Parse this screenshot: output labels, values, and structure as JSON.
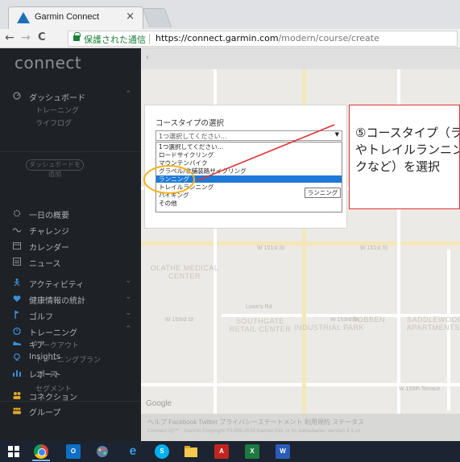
{
  "browser": {
    "tab_title": "Garmin Connect",
    "tab_close": "×",
    "nav_back": "←",
    "nav_forward": "→",
    "nav_reload": "C",
    "secure_label": "保護された通信",
    "url_host": "https://connect.garmin.com",
    "url_path": "/modern/course/create"
  },
  "sidebar": {
    "logo": "connect",
    "dashboard": "ダッシュボード",
    "dashboard_sub": [
      "トレーニング",
      "ライフログ"
    ],
    "dashboard_edit": "ダッシュボードを追加",
    "items": [
      "一日の概要",
      "チャレンジ",
      "カレンダー",
      "ニュース",
      "アクティビティ",
      "健康情報の統計",
      "ゴルフ",
      "トレーニング"
    ],
    "training_sub": [
      "ワークアウト",
      "トレーニングプラン",
      "コース",
      "セグメント"
    ],
    "bottom_items": [
      "ギア",
      "Insights",
      "レポート",
      "コネクション",
      "グループ"
    ],
    "chevron": "⌃"
  },
  "map": {
    "back_arrow": "‹",
    "labels": {
      "olathe": "OLATHE MEDICAL CENTER",
      "southgate": "SOUTHGATE RETAIL CENTER",
      "industrial": "INDUSTRIAL PARK",
      "robben": "ROBBEN",
      "saddlewood": "SADDLEWOOD APARTMENTS",
      "st1": "W 151st St",
      "st2": "W 151st St",
      "st3": "W 153rd St",
      "st4": "W 153rd St",
      "st5": "Lowe's Rd",
      "st6": "W 155th Terrace"
    },
    "google": "Google",
    "footer_links": "ヘルプ   Facebook   Twitter   プライバシーステートメント   利用規約   ステータス",
    "footer_copy": "Connect IQ™ · Garmin   Copyright ©1996-2018 Garmin Ltd. or its subsidiaries   Version 4.1.xx"
  },
  "course_panel": {
    "title": "コースタイプの選択",
    "select_value": "1つ選択してください…",
    "select_arrow": "▼",
    "options": [
      "1つ選択してください…",
      "ロードサイクリング",
      "マウンテンバイク",
      "グラベル/非舗装路サイクリング",
      "ランニング",
      "トレイルランニング",
      "ハイキング",
      "その他"
    ],
    "selected_index": 4,
    "tooltip": "ランニング"
  },
  "annotation": {
    "text": "⑤コースタイプ（ランニングやトレイルランニング、ハイクなど）を選択"
  },
  "taskbar": {
    "apps": [
      "start",
      "chrome",
      "outlook",
      "paint",
      "edge",
      "skype",
      "explorer",
      "acrobat",
      "excel",
      "word"
    ],
    "outlook_label": "O",
    "edge_label": "e",
    "skype_label": "S",
    "acrobat_label": "A",
    "excel_label": "X",
    "word_label": "W"
  }
}
